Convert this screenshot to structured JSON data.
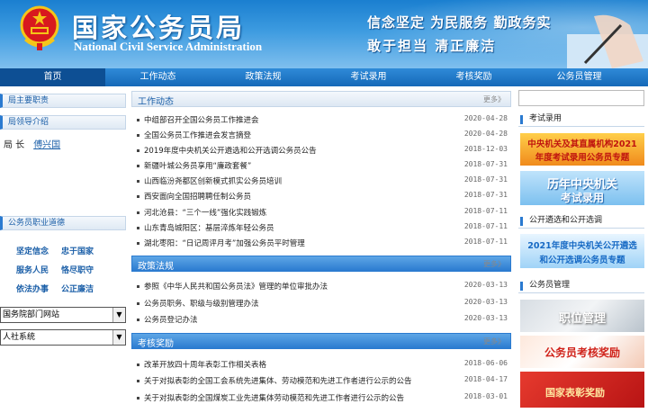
{
  "header": {
    "title": "国家公务员局",
    "subtitle": "National Civil Service Administration",
    "slogan_line1": "信念坚定 为民服务 勤政务实",
    "slogan_line2": "敢于担当 清正廉洁"
  },
  "nav": [
    "首页",
    "工作动态",
    "政策法规",
    "考试录用",
    "考核奖励",
    "公务员管理"
  ],
  "sidebar": {
    "main_duties": "局主要职责",
    "leaders_intro": "局领导介绍",
    "leader_title": "局 长",
    "leader_name": "傅兴国",
    "ethics_head": "公务员职业道德",
    "values": [
      "坚定信念",
      "忠于国家",
      "服务人民",
      "恪尽职守",
      "依法办事",
      "公正廉洁"
    ],
    "select1": "国务院部门网站",
    "select2": "人社系统"
  },
  "sections": [
    {
      "title": "工作动态",
      "more": "更多》",
      "items": [
        {
          "text": "中组部召开全国公务员工作推进会",
          "date": "2020-04-28"
        },
        {
          "text": "全国公务员工作推进会发言摘登",
          "date": "2020-04-28"
        },
        {
          "text": "2019年度中央机关公开遴选和公开选调公务员公告",
          "date": "2018-12-03"
        },
        {
          "text": "新疆叶城公务员享用“廉政套餐”",
          "date": "2018-07-31"
        },
        {
          "text": "山西临汾尧都区创新模式抓实公务员培训",
          "date": "2018-07-31"
        },
        {
          "text": "西安面向全国招聘聘任制公务员",
          "date": "2018-07-31"
        },
        {
          "text": "河北沧县：“三个一线”强化实践锻炼",
          "date": "2018-07-11"
        },
        {
          "text": "山东青岛城阳区：基层淬炼年轻公务员",
          "date": "2018-07-11"
        },
        {
          "text": "湖北枣阳：“日记周评月考”加强公务员平时管理",
          "date": "2018-07-11"
        }
      ]
    },
    {
      "title": "政策法规",
      "more": "更多》",
      "items": [
        {
          "text": "参照《中华人民共和国公务员法》管理的单位审批办法",
          "date": "2020-03-13"
        },
        {
          "text": "公务员职务、职级与级别管理办法",
          "date": "2020-03-13"
        },
        {
          "text": "公务员登记办法",
          "date": "2020-03-13"
        }
      ]
    },
    {
      "title": "考核奖励",
      "more": "更多》",
      "items": [
        {
          "text": "改革开放四十周年表彰工作相关表格",
          "date": "2018-06-06"
        },
        {
          "text": "关于对拟表彰的全国工会系统先进集体、劳动模范和先进工作者进行公示的公告",
          "date": "2018-04-17"
        },
        {
          "text": "关于对拟表彰的全国煤炭工业先进集体劳动模范和先进工作者进行公示的公告",
          "date": "2018-03-01"
        }
      ]
    }
  ],
  "right": {
    "exam_head": "考试录用",
    "banner1": [
      "中央机关及其直属机构2021",
      "年度考试录用公务员专题"
    ],
    "banner2": [
      "历年中央机关",
      "考试录用"
    ],
    "select_head": "公开遴选和公开选调",
    "banner3": [
      "2021年度中央机关公开遴选",
      "和公开选调公务员专题"
    ],
    "mgmt_head": "公务员管理",
    "banner4": "职位管理",
    "banner5": "公务员考核奖励",
    "banner6": "国家表彰奖励"
  }
}
